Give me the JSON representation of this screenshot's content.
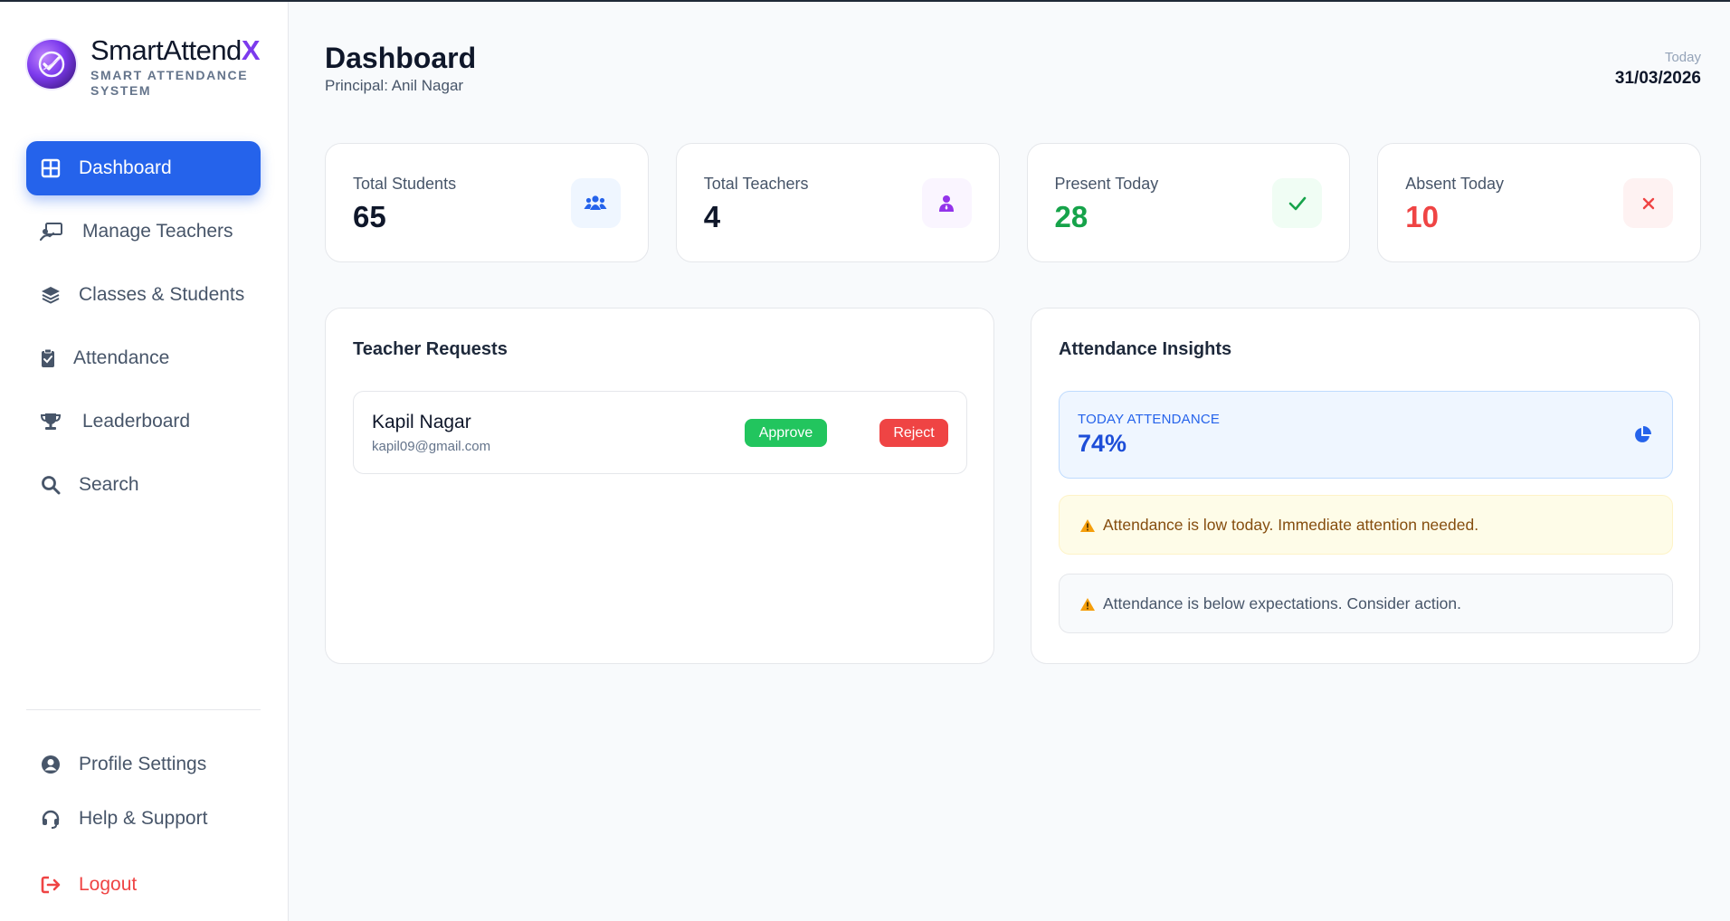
{
  "brand": {
    "name_main": "SmartAttend",
    "name_accent": "X",
    "subtitle": "SMART ATTENDANCE SYSTEM"
  },
  "sidebar": {
    "items": [
      {
        "label": "Dashboard",
        "icon": "grid-icon",
        "active": true
      },
      {
        "label": "Manage Teachers",
        "icon": "chalkboard-teacher-icon"
      },
      {
        "label": "Classes & Students",
        "icon": "layers-icon"
      },
      {
        "label": "Attendance",
        "icon": "clipboard-check-icon"
      },
      {
        "label": "Leaderboard",
        "icon": "trophy-icon"
      },
      {
        "label": "Search",
        "icon": "search-icon"
      }
    ],
    "bottom_items": [
      {
        "label": "Profile Settings",
        "icon": "user-circle-icon"
      },
      {
        "label": "Help & Support",
        "icon": "headset-icon"
      }
    ],
    "logout": {
      "label": "Logout",
      "icon": "logout-icon"
    }
  },
  "header": {
    "title": "Dashboard",
    "subtitle": "Principal: Anil Nagar",
    "date_label": "Today",
    "date_value": "31/03/2026"
  },
  "stats": [
    {
      "label": "Total Students",
      "value": "65",
      "icon": "users-icon",
      "value_color": "#0f172a",
      "icon_bg": "#eff6ff",
      "icon_color": "#2563eb"
    },
    {
      "label": "Total Teachers",
      "value": "4",
      "icon": "teacher-icon",
      "value_color": "#0f172a",
      "icon_bg": "#faf5ff",
      "icon_color": "#9333ea"
    },
    {
      "label": "Present Today",
      "value": "28",
      "icon": "check-icon",
      "value_color": "#16a34a",
      "icon_bg": "#f0fdf4",
      "icon_color": "#16a34a"
    },
    {
      "label": "Absent Today",
      "value": "10",
      "icon": "x-icon",
      "value_color": "#ef4444",
      "icon_bg": "#fef2f2",
      "icon_color": "#ef4444"
    }
  ],
  "teacher_requests": {
    "title": "Teacher Requests",
    "items": [
      {
        "name": "Kapil Nagar",
        "email": "kapil09@gmail.com",
        "approve_label": "Approve",
        "reject_label": "Reject"
      }
    ]
  },
  "insights": {
    "title": "Attendance Insights",
    "today_label": "TODAY ATTENDANCE",
    "today_value": "74%",
    "alert_low": "Attendance is low today. Immediate attention needed.",
    "alert_below": "Attendance is below expectations. Consider action."
  },
  "colors": {
    "accent": "#2563eb",
    "brand_accent": "#7c3aed",
    "success": "#22c55e",
    "danger": "#ef4444"
  }
}
